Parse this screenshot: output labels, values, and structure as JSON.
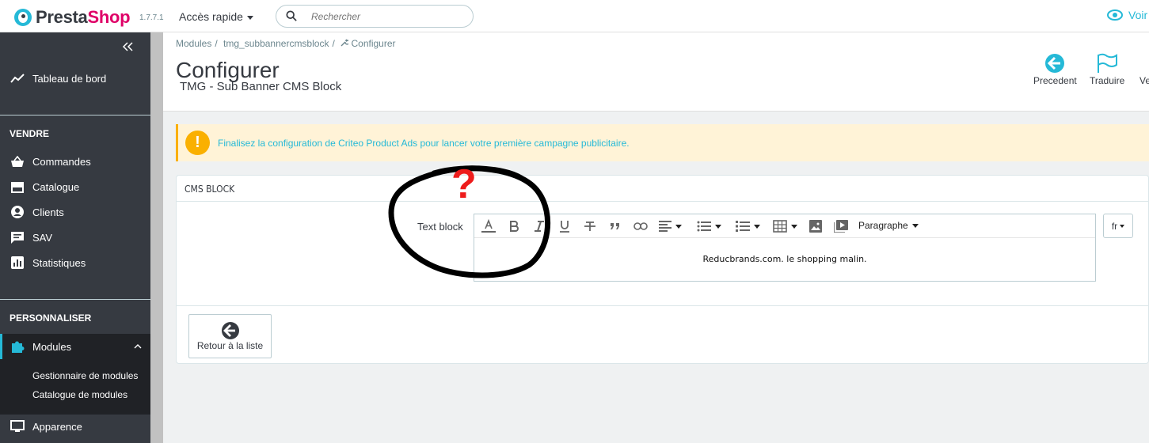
{
  "header": {
    "brand_prefix": "Presta",
    "brand_suffix": "Shop",
    "version": "1.7.7.1",
    "quick_access": "Accès rapide",
    "search_placeholder": "Rechercher",
    "view_shop": "Voir"
  },
  "sidebar": {
    "dashboard": "Tableau de bord",
    "section_sell": "VENDRE",
    "orders": "Commandes",
    "catalog": "Catalogue",
    "customers": "Clients",
    "support": "SAV",
    "stats": "Statistiques",
    "section_customize": "PERSONNALISER",
    "modules": "Modules",
    "module_manager": "Gestionnaire de modules",
    "module_catalog": "Catalogue de modules",
    "appearance": "Apparence"
  },
  "page": {
    "breadcrumb": [
      "Modules",
      "tmg_subbannercmsblock",
      "Configurer"
    ],
    "title": "Configurer",
    "subtitle": "TMG - Sub Banner CMS Block",
    "toolbar": {
      "back": "Precedent",
      "translate": "Traduire",
      "view": "Ve"
    }
  },
  "alert": {
    "text": "Finalisez la configuration de Criteo Product Ads pour lancer votre première campagne publicitaire."
  },
  "panel": {
    "title": "CMS BLOCK",
    "field_label": "Text block",
    "format_select": "Paragraphe",
    "content": "Reducbrands.com. le shopping malin.",
    "language": "fr",
    "back_button": "Retour à la liste"
  },
  "annotation": {
    "mark": "?"
  },
  "colors": {
    "accent": "#25b9d7",
    "sidebar_bg": "#363a41",
    "brand": "#df0067",
    "warning": "#fab000",
    "annotation_red": "#ee1c1c"
  }
}
